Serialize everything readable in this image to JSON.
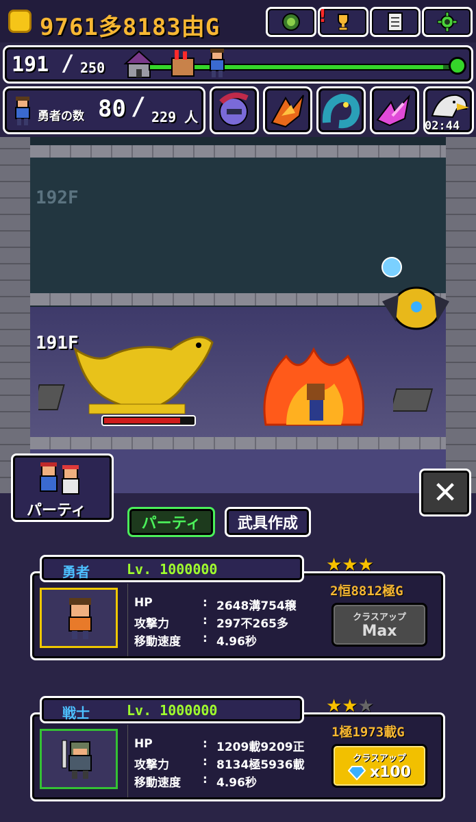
{
  "topbar": {
    "gold_amount": "9761多8183由G",
    "icons": [
      "orb-icon",
      "trophy-icon",
      "memo-icon",
      "settings-icon"
    ]
  },
  "progress": {
    "current_floor": "191",
    "max_floor": "250",
    "completion": 0.96
  },
  "heroes": {
    "label": "勇者の数",
    "count": "80",
    "total": "229 人",
    "timer": "02:44"
  },
  "scene": {
    "floor_upper_label": "192F",
    "floor_lower_label": "191F",
    "enemy_hp_fraction": 0.85
  },
  "party": {
    "panel_label": "パーティ",
    "tabs": [
      "パーティ",
      "武具作成"
    ],
    "close_label": "✕"
  },
  "members": [
    {
      "name": "勇者",
      "level": "Lv. 1000000",
      "stars": 3,
      "price": "2恒8812極G",
      "stats": [
        {
          "label": "HP",
          "value": "2648溝754穣"
        },
        {
          "label": "攻撃力",
          "value": "297不265多"
        },
        {
          "label": "移動速度",
          "value": "4.96秒"
        }
      ],
      "button_top": "クラスアップ",
      "button_bottom": "Max"
    },
    {
      "name": "戦士",
      "level": "Lv. 1000000",
      "stars": 2,
      "price": "1極1973載G",
      "stats": [
        {
          "label": "HP",
          "value": "1209載9209正"
        },
        {
          "label": "攻撃力",
          "value": "8134極5936載"
        },
        {
          "label": "移動速度",
          "value": "4.96秒"
        }
      ],
      "button_top": "クラスアップ",
      "button_bottom": "x100"
    }
  ],
  "colors": {
    "gold": "#f7b733",
    "name_blue": "#4cc0ff",
    "level_green": "#a0ff2e",
    "tab_green": "#4bf05a"
  }
}
